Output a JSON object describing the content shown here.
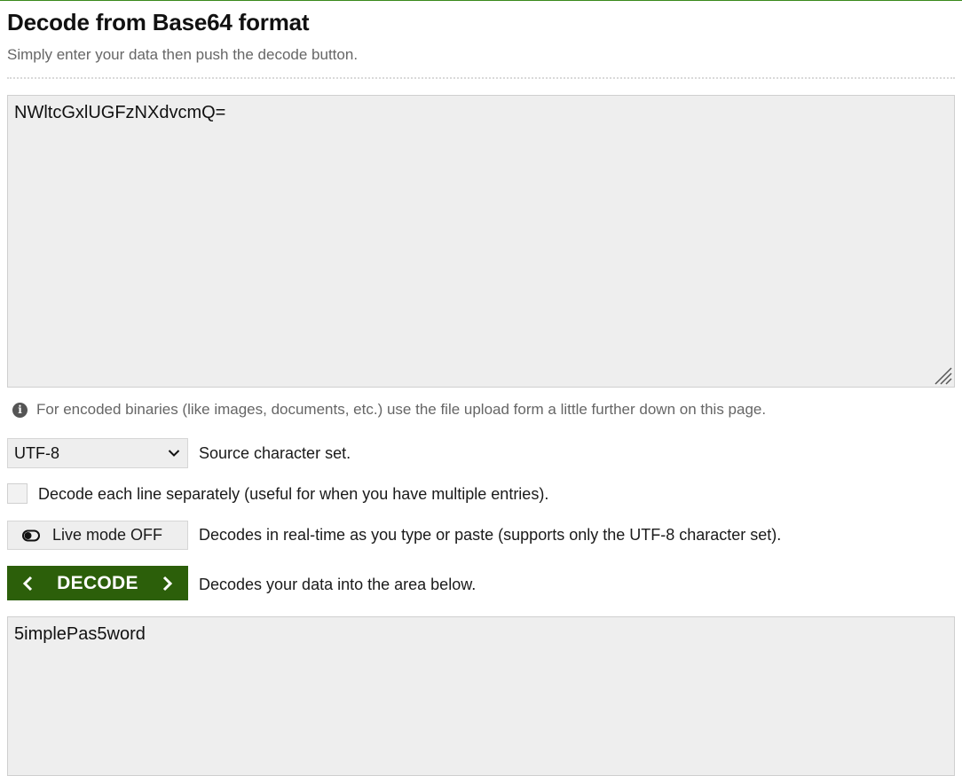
{
  "page": {
    "title": "Decode from Base64 format",
    "subtitle": "Simply enter your data then push the decode button."
  },
  "input": {
    "value": "NWltcGxlUGFzNXdvcmQ="
  },
  "info": {
    "text": "For encoded binaries (like images, documents, etc.) use the file upload form a little further down on this page."
  },
  "charset": {
    "selected": "UTF-8",
    "label": "Source character set."
  },
  "line_option": {
    "label": "Decode each line separately (useful for when you have multiple entries).",
    "checked": false
  },
  "live_mode": {
    "button_label": "Live mode OFF",
    "description": "Decodes in real-time as you type or paste (supports only the UTF-8 character set)."
  },
  "decode": {
    "button_label": "DECODE",
    "description": "Decodes your data into the area below."
  },
  "output": {
    "value": "5implePas5word"
  },
  "colors": {
    "accent": "#2c5f0a",
    "field_bg": "#eeeeee",
    "muted_text": "#666666"
  }
}
